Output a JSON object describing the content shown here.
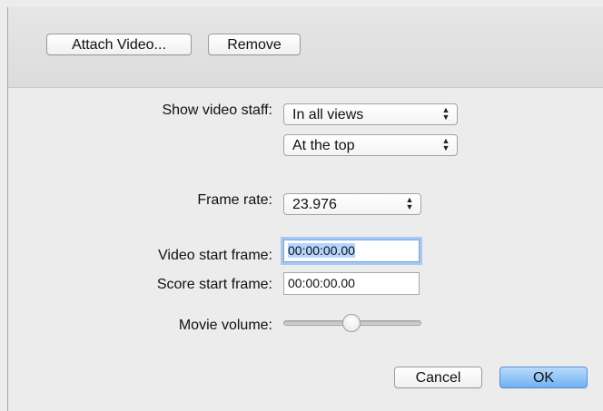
{
  "toolbar": {
    "attach_label": "Attach Video...",
    "remove_label": "Remove"
  },
  "video_staff": {
    "label": "Show video staff:",
    "views_value": "In all views",
    "position_value": "At the top"
  },
  "frame_rate": {
    "label": "Frame rate:",
    "value": "23.976"
  },
  "video_start": {
    "label": "Video start frame:",
    "value": "00:00:00.00"
  },
  "score_start": {
    "label": "Score start frame:",
    "value": "00:00:00.00"
  },
  "movie_volume": {
    "label": "Movie volume:",
    "level": 0.5
  },
  "footer": {
    "cancel_label": "Cancel",
    "ok_label": "OK"
  }
}
